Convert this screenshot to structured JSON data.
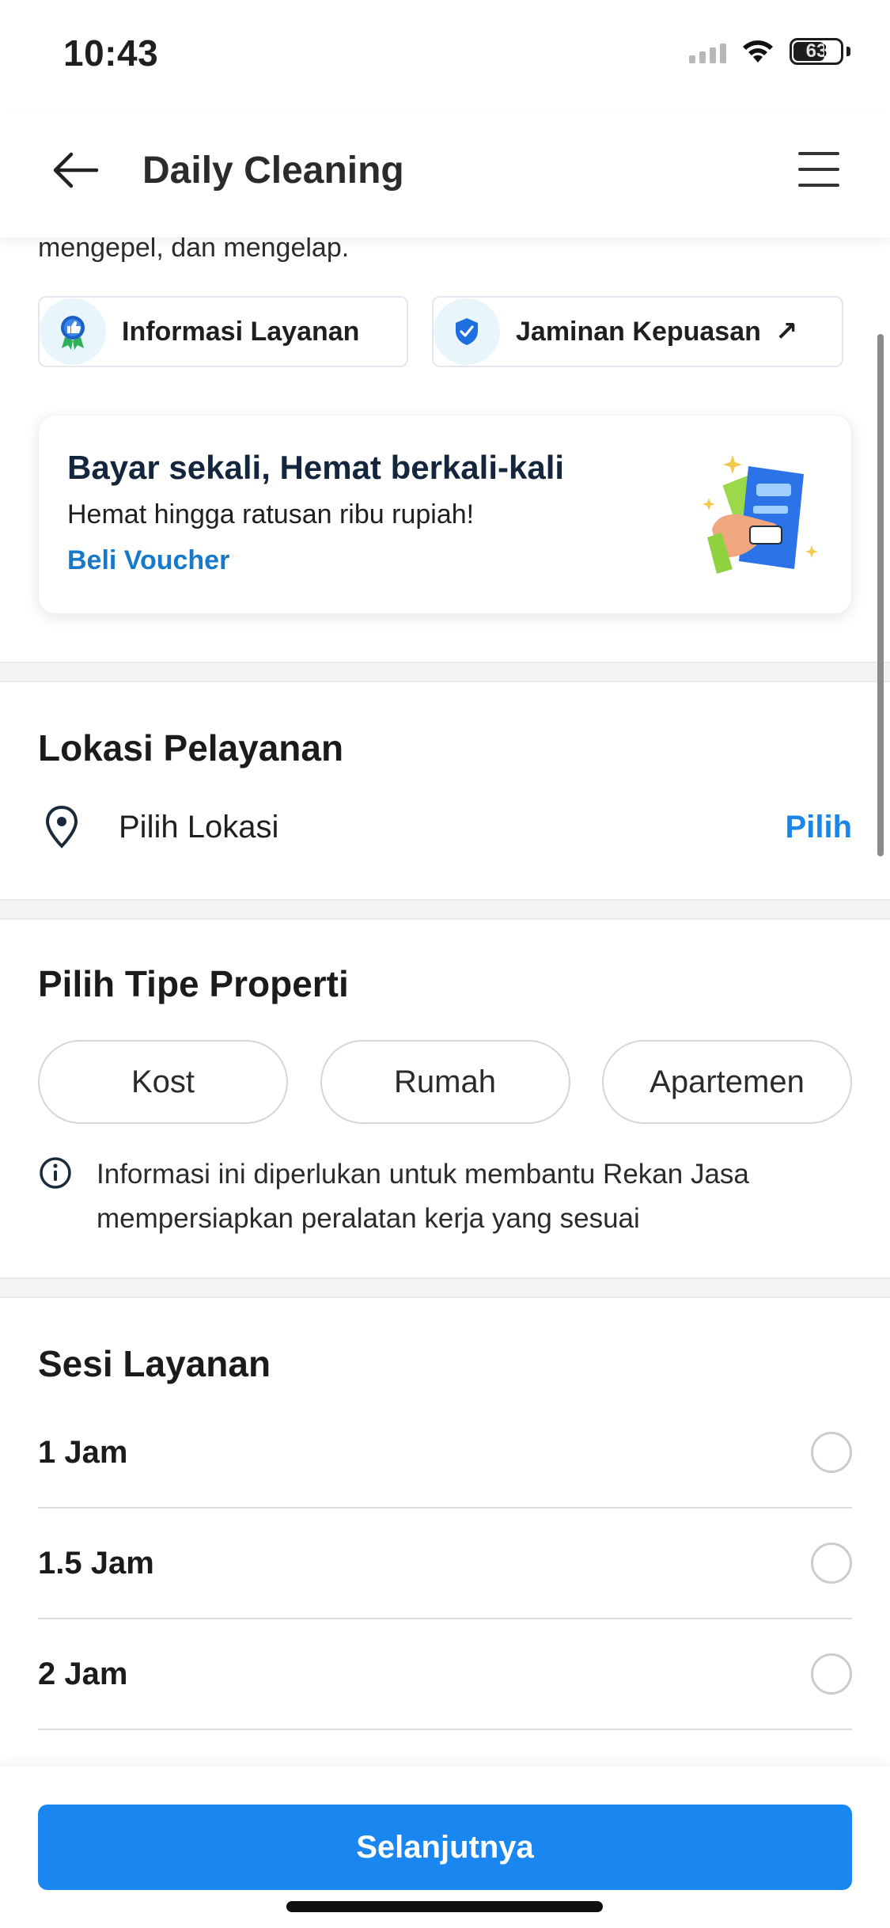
{
  "status_bar": {
    "time": "10:43",
    "battery": "63"
  },
  "header": {
    "title": "Daily Cleaning"
  },
  "description_tail": "mengepel, dan mengelap.",
  "chips": [
    {
      "label": "Informasi Layanan",
      "icon": "badge-thumbs-up-icon"
    },
    {
      "label": "Jaminan Kepuasan",
      "icon": "shield-check-icon",
      "arrow": "↗"
    }
  ],
  "promo": {
    "title": "Bayar sekali, Hemat berkali-kali",
    "subtitle": "Hemat hingga ratusan ribu rupiah!",
    "link": "Beli Voucher"
  },
  "location": {
    "title": "Lokasi Pelayanan",
    "label": "Pilih Lokasi",
    "action": "Pilih"
  },
  "property": {
    "title": "Pilih Tipe Properti",
    "options": [
      "Kost",
      "Rumah",
      "Apartemen"
    ],
    "info": "Informasi ini diperlukan untuk membantu Rekan Jasa mempersiapkan peralatan kerja yang sesuai"
  },
  "session": {
    "title": "Sesi Layanan",
    "options": [
      "1 Jam",
      "1.5 Jam",
      "2 Jam"
    ]
  },
  "cta": {
    "label": "Selanjutnya"
  },
  "colors": {
    "primary": "#1a86f0",
    "link": "#1679c9",
    "heading": "#13263d"
  }
}
